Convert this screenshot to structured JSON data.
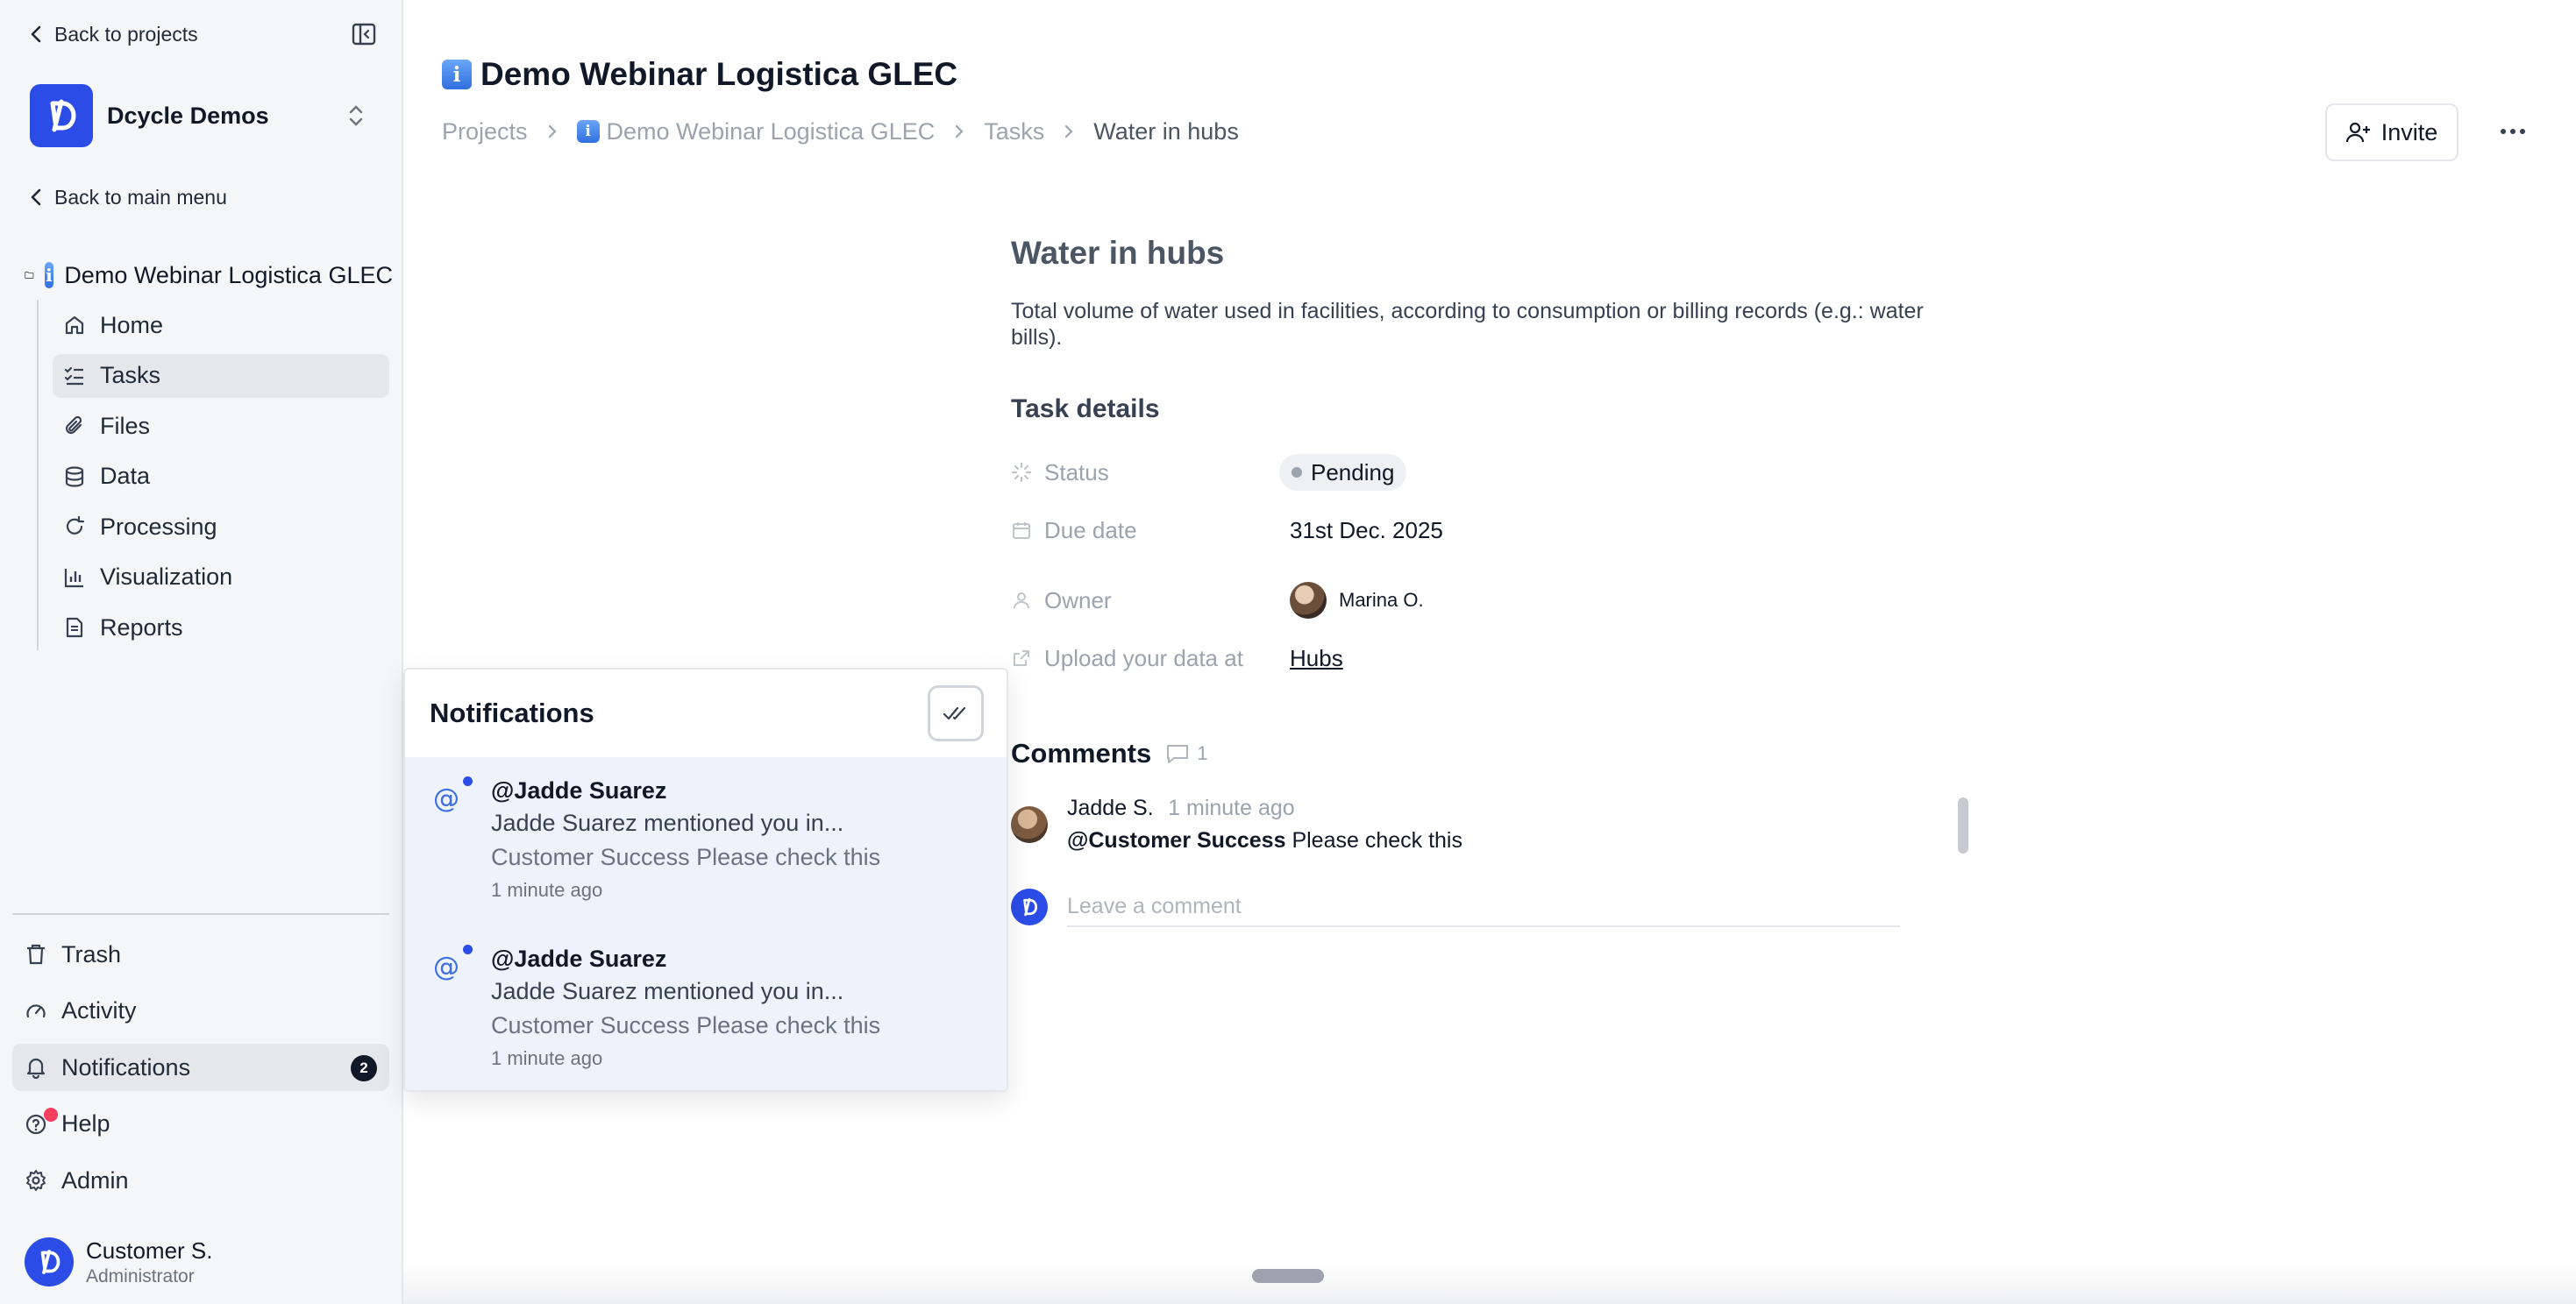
{
  "sidebar": {
    "back_to_projects": "Back to projects",
    "org_name": "Dcycle Demos",
    "back_to_main_menu": "Back to main menu",
    "project_name": "Demo Webinar Logistica GLEC",
    "items": [
      {
        "label": "Home",
        "icon": "home-icon"
      },
      {
        "label": "Tasks",
        "icon": "tasks-icon",
        "active": true
      },
      {
        "label": "Files",
        "icon": "paperclip-icon"
      },
      {
        "label": "Data",
        "icon": "database-icon"
      },
      {
        "label": "Processing",
        "icon": "refresh-icon"
      },
      {
        "label": "Visualization",
        "icon": "bar-chart-icon"
      },
      {
        "label": "Reports",
        "icon": "document-icon"
      }
    ],
    "bottom_items": [
      {
        "label": "Trash",
        "icon": "trash-icon"
      },
      {
        "label": "Activity",
        "icon": "gauge-icon"
      },
      {
        "label": "Notifications",
        "icon": "bell-icon",
        "badge": "2",
        "active": true
      },
      {
        "label": "Help",
        "icon": "help-icon"
      },
      {
        "label": "Admin",
        "icon": "gear-icon"
      }
    ],
    "user": {
      "name": "Customer S.",
      "role": "Administrator"
    }
  },
  "header": {
    "title": "Demo Webinar Logistica GLEC",
    "breadcrumb": [
      "Projects",
      "Demo Webinar Logistica GLEC",
      "Tasks",
      "Water in hubs"
    ],
    "invite_label": "Invite"
  },
  "task": {
    "title": "Water in hubs",
    "description": "Total volume of water used in facilities, according to consumption or billing records (e.g.: water bills).",
    "details_title": "Task details",
    "details": {
      "status_label": "Status",
      "status_value": "Pending",
      "due_label": "Due date",
      "due_value": "31st Dec. 2025",
      "owner_label": "Owner",
      "owner_value": "Marina O.",
      "upload_label": "Upload your data at",
      "upload_value": "Hubs"
    }
  },
  "comments": {
    "title": "Comments",
    "count": "1",
    "items": [
      {
        "author": "Jadde S.",
        "time": "1 minute ago",
        "mention": "@Customer Success",
        "text": "Please check this"
      }
    ],
    "input_placeholder": "Leave a comment"
  },
  "notifications": {
    "title": "Notifications",
    "items": [
      {
        "title": "@Jadde Suarez",
        "subtitle": "Jadde Suarez mentioned you in...",
        "preview": "Customer Success Please check this",
        "time": "1 minute ago"
      },
      {
        "title": "@Jadde Suarez",
        "subtitle": "Jadde Suarez mentioned you in...",
        "preview": "Customer Success Please check this",
        "time": "1 minute ago"
      }
    ]
  },
  "colors": {
    "brand": "#2c4ce8",
    "badge": "#111827",
    "help_dot": "#f43f5e",
    "unread_bg": "#edf2fb"
  }
}
